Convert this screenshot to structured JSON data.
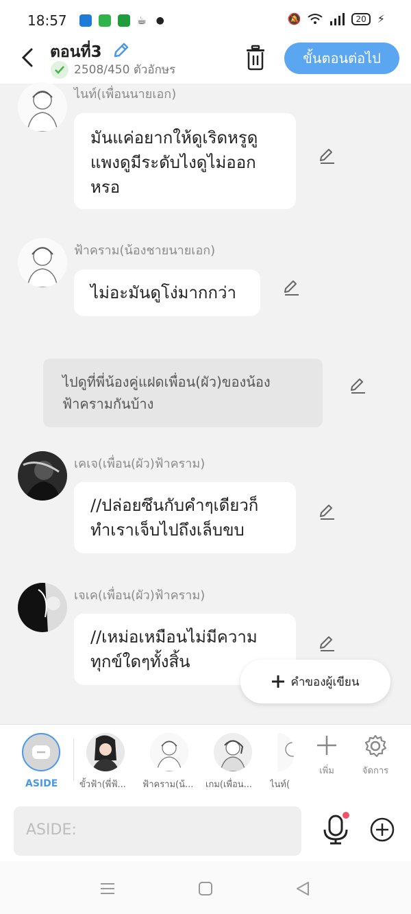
{
  "status_bar": {
    "time": "18:57",
    "battery": "20",
    "app_icons": [
      "#1e7bd8",
      "#2fb34a",
      "#1f9d3c",
      "#333333"
    ]
  },
  "header": {
    "title": "ตอนที่3",
    "word_count": "2508/450 ตัวอักษร",
    "next_label": "ขั้นตอนต่อไป",
    "accent": "#5aa6f0"
  },
  "messages": [
    {
      "name": "ไนท์(เพื่อนนายเอก)",
      "lines": [
        "มันแค่อยากให้ดูเริดหรูดู",
        "แพงดูมีระดับไงดูไม่ออก",
        "หรอ"
      ]
    },
    {
      "name": "ฟ้าคราม(น้องชายนายเอก)",
      "lines": [
        "ไม่อะมันดูโง่มากกว่า"
      ]
    },
    {
      "narration": [
        "ไปดูที่พี่น้องคู่แฝดเพื่อน(ผัว)ของน้อง",
        "ฟ้าครามกันบ้าง"
      ]
    },
    {
      "name": "เคเจ(เพื่อน(ผัว)ฟ้าคราม)",
      "lines": [
        "//ปล่อยซึนกับคำๆเดียวก็",
        "ทำเราเจ็บไปถึงเล็บขบ"
      ]
    },
    {
      "name": "เจเค(เพื่อน(ผัว)ฟ้าคราม)",
      "lines": [
        "//เหม่อเหมือนไม่มีความ",
        "ทุกข์ใดๆทั้งสิ้น"
      ]
    }
  ],
  "author_button": {
    "label": "คำของผู้เขียน"
  },
  "characters": {
    "aside_label": "ASIDE",
    "items": [
      {
        "name": "ขั้วฟ้า(พี่ฟ้..."
      },
      {
        "name": "ฟ้าคราม(น้..."
      },
      {
        "name": "เกม(เพื่อน..."
      },
      {
        "name": "ไนท์("
      }
    ],
    "add_label": "เพิ่ม",
    "manage_label": "จัดการ"
  },
  "input": {
    "placeholder": "ASIDE:"
  }
}
